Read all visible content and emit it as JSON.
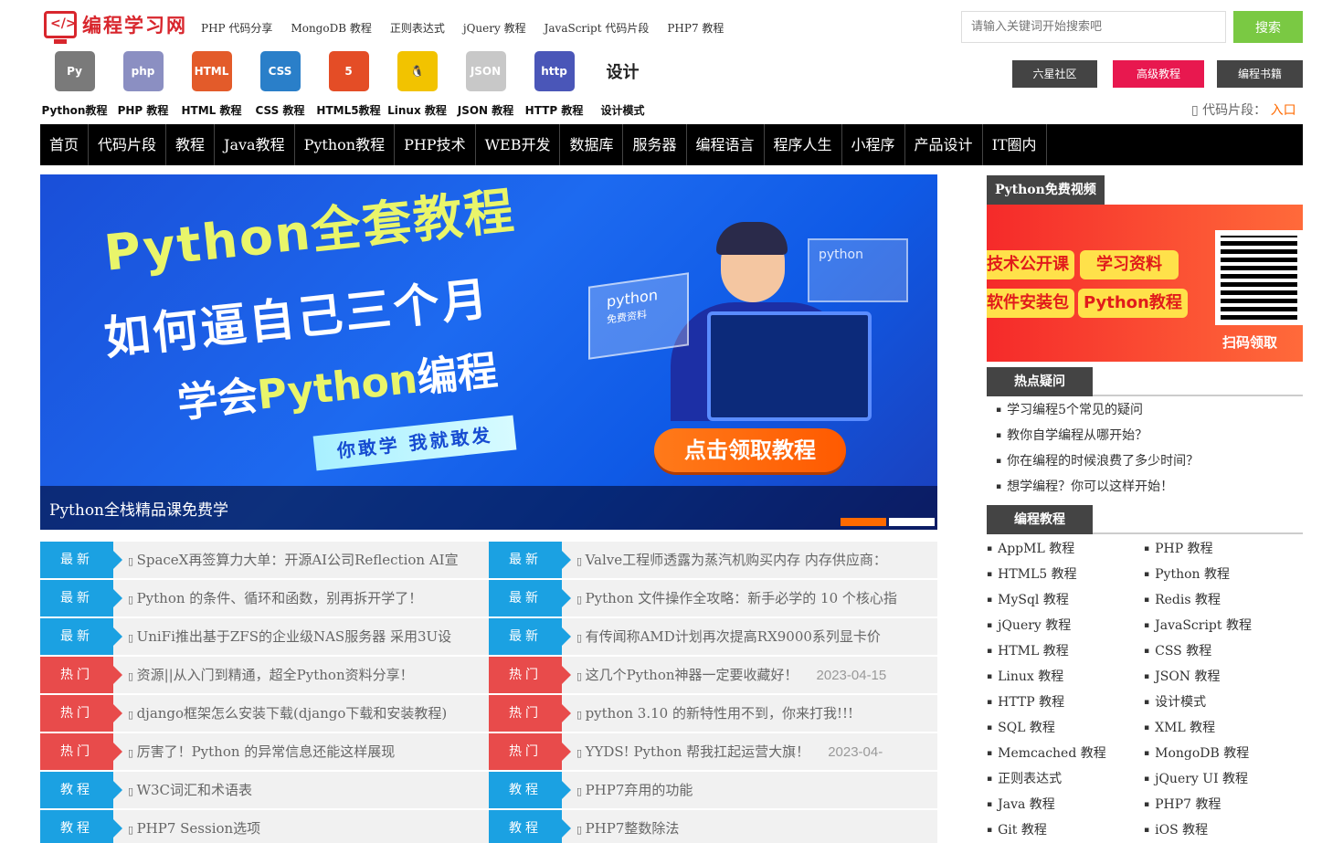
{
  "header": {
    "logo_text": "编程学习网",
    "top_links": [
      "PHP 代码分享",
      "MongoDB 教程",
      "正则表达式",
      "jQuery 教程",
      "JavaScript 代码片段",
      "PHP7 教程"
    ],
    "search_placeholder": "请输入关键词开始搜索吧",
    "search_button": "搜索",
    "buttons": [
      "六星社区",
      "高级教程",
      "编程书籍"
    ],
    "snippet_label": "代码片段：",
    "snippet_link": "入口"
  },
  "tech_icons": [
    {
      "label": "Python教程",
      "glyph": "Py",
      "color": "#7a7a7a"
    },
    {
      "label": "PHP 教程",
      "glyph": "php",
      "color": "#8b8fc2"
    },
    {
      "label": "HTML 教程",
      "glyph": "HTML",
      "color": "#e35b2a"
    },
    {
      "label": "CSS 教程",
      "glyph": "CSS",
      "color": "#2a7fc9"
    },
    {
      "label": "HTML5教程",
      "glyph": "5",
      "color": "#e44d26"
    },
    {
      "label": "Linux 教程",
      "glyph": "🐧",
      "color": "#f2c300"
    },
    {
      "label": "JSON 教程",
      "glyph": "JSON",
      "color": "#c8c8c8"
    },
    {
      "label": "HTTP 教程",
      "glyph": "http",
      "color": "#4a56b8"
    },
    {
      "label": "设计模式",
      "glyph": "设计",
      "color": "#ffffff"
    }
  ],
  "nav": [
    "首页",
    "代码片段",
    "教程",
    "Java教程",
    "Python教程",
    "PHP技术",
    "WEB开发",
    "数据库",
    "服务器",
    "编程语言",
    "程序人生",
    "小程序",
    "产品设计",
    "IT圈内"
  ],
  "banner": {
    "line1": "Python全套教程",
    "line2": "如何逼自己三个月",
    "line3a": "学会",
    "line3b": "Python",
    "line3c": "编程",
    "slogan": "你敢学 我就敢发",
    "cta": "点击领取教程",
    "panel1": "python",
    "panel1_sub": "免费资料",
    "panel2": "python",
    "caption": "Python全栈精品课免费学"
  },
  "news_left": [
    {
      "tag": "最新",
      "text": "SpaceX再签算力大单：开源AI公司Reflection AI宣",
      "date": ""
    },
    {
      "tag": "最新",
      "text": "Python 的条件、循环和函数，别再拆开学了！",
      "date": ""
    },
    {
      "tag": "最新",
      "text": "UniFi推出基于ZFS的企业级NAS服务器 采用3U设",
      "date": ""
    },
    {
      "tag": "热门",
      "text": "资源||从入门到精通，超全Python资料分享！",
      "date": ""
    },
    {
      "tag": "热门",
      "text": "django框架怎么安装下载(django下载和安装教程)",
      "date": ""
    },
    {
      "tag": "热门",
      "text": "厉害了！Python 的异常信息还能这样展现",
      "date": ""
    },
    {
      "tag": "教程",
      "text": "W3C词汇和术语表",
      "date": ""
    },
    {
      "tag": "教程",
      "text": "PHP7 Session选项",
      "date": ""
    }
  ],
  "news_right": [
    {
      "tag": "最新",
      "text": "Valve工程师透露为蒸汽机购买内存 内存供应商：",
      "date": ""
    },
    {
      "tag": "最新",
      "text": "Python 文件操作全攻略：新手必学的 10 个核心指",
      "date": ""
    },
    {
      "tag": "最新",
      "text": "有传闻称AMD计划再次提高RX9000系列显卡价",
      "date": ""
    },
    {
      "tag": "热门",
      "text": "这几个Python神器一定要收藏好！",
      "date": "2023-04-15"
    },
    {
      "tag": "热门",
      "text": "python 3.10 的新特性用不到，你来打我!!!",
      "date": ""
    },
    {
      "tag": "热门",
      "text": "YYDS! Python 帮我扛起运营大旗！",
      "date": "2023-04-"
    },
    {
      "tag": "教程",
      "text": "PHP7弃用的功能",
      "date": ""
    },
    {
      "tag": "教程",
      "text": "PHP7整数除法",
      "date": ""
    }
  ],
  "tag_colors": {
    "最新": "#1ba1e2",
    "热门": "#e84b4b",
    "教程": "#1ba1e2"
  },
  "sidebar": {
    "video_title": "Python免费视频",
    "promo_pills": [
      "技术公开课",
      "学习资料",
      "软件安装包",
      "Python教程"
    ],
    "promo_scan": "扫码领取",
    "hot_title": "热点疑问",
    "hot_items": [
      "学习编程5个常见的疑问",
      "教你自学编程从哪开始？",
      "你在编程的时候浪费了多少时间？",
      "想学编程？你可以这样开始！"
    ],
    "course_title": "编程教程",
    "courses_left": [
      "AppML 教程",
      "HTML5 教程",
      "MySql 教程",
      "jQuery 教程",
      "HTML 教程",
      "Linux 教程",
      "HTTP 教程",
      "SQL 教程",
      "Memcached 教程",
      "正则表达式",
      "Java 教程",
      "Git 教程"
    ],
    "courses_right": [
      "PHP 教程",
      "Python 教程",
      "Redis 教程",
      "JavaScript 教程",
      "CSS 教程",
      "JSON 教程",
      "设计模式",
      "XML 教程",
      "MongoDB 教程",
      "jQuery UI 教程",
      "PHP7 教程",
      "iOS 教程"
    ]
  }
}
